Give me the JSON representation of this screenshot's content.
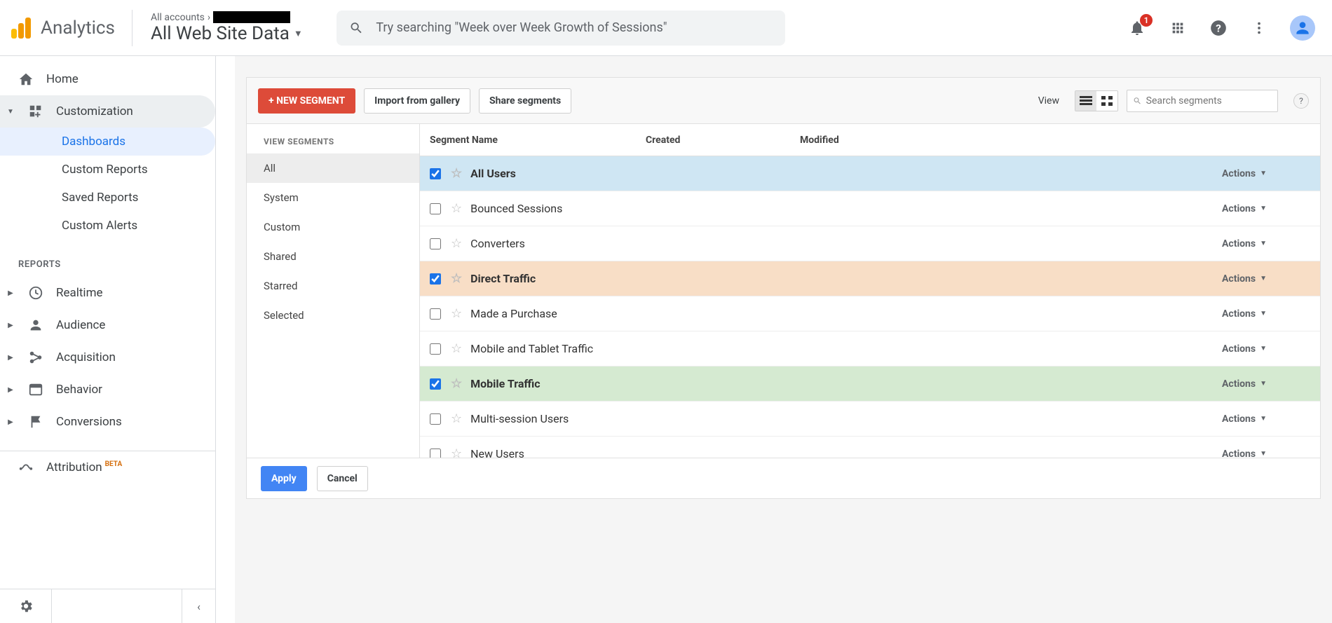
{
  "header": {
    "product": "Analytics",
    "breadcrumb_prefix": "All accounts",
    "view_name": "All Web Site Data",
    "search_placeholder": "Try searching \"Week over Week Growth of Sessions\"",
    "notification_count": "1"
  },
  "nav": {
    "home": "Home",
    "customization": "Customization",
    "customization_items": {
      "dashboards": "Dashboards",
      "custom_reports": "Custom Reports",
      "saved_reports": "Saved Reports",
      "custom_alerts": "Custom Alerts"
    },
    "reports_label": "REPORTS",
    "realtime": "Realtime",
    "audience": "Audience",
    "acquisition": "Acquisition",
    "behavior": "Behavior",
    "conversions": "Conversions",
    "attribution": "Attribution",
    "attribution_badge": "BETA"
  },
  "segments": {
    "new_segment": "+ NEW SEGMENT",
    "import": "Import from gallery",
    "share": "Share segments",
    "view_label": "View",
    "search_placeholder": "Search segments",
    "help": "?",
    "side_label": "VIEW SEGMENTS",
    "filters": {
      "all": "All",
      "system": "System",
      "custom": "Custom",
      "shared": "Shared",
      "starred": "Starred",
      "selected": "Selected"
    },
    "columns": {
      "name": "Segment Name",
      "created": "Created",
      "modified": "Modified"
    },
    "actions_label": "Actions",
    "rows": [
      {
        "name": "All Users",
        "checked": true,
        "tone": "blue"
      },
      {
        "name": "Bounced Sessions",
        "checked": false,
        "tone": ""
      },
      {
        "name": "Converters",
        "checked": false,
        "tone": ""
      },
      {
        "name": "Direct Traffic",
        "checked": true,
        "tone": "orange"
      },
      {
        "name": "Made a Purchase",
        "checked": false,
        "tone": ""
      },
      {
        "name": "Mobile and Tablet Traffic",
        "checked": false,
        "tone": ""
      },
      {
        "name": "Mobile Traffic",
        "checked": true,
        "tone": "green"
      },
      {
        "name": "Multi-session Users",
        "checked": false,
        "tone": ""
      },
      {
        "name": "New Users",
        "checked": false,
        "tone": ""
      }
    ],
    "apply": "Apply",
    "cancel": "Cancel"
  }
}
